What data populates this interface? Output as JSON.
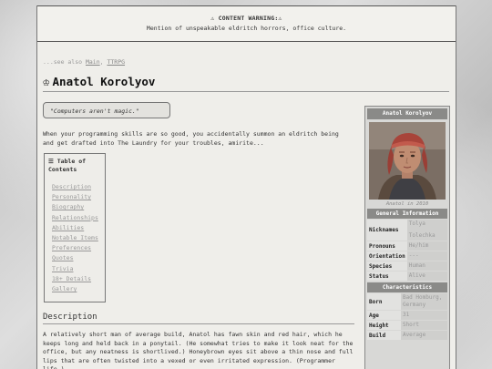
{
  "warning": {
    "title": "⚠ CONTENT WARNING:⚠",
    "text": "Mention of unspeakable eldritch horrors, office culture."
  },
  "see_also": {
    "prefix": "...see also ",
    "links": [
      "Main",
      "TTRPG"
    ],
    "separator": ", "
  },
  "page": {
    "title_icon": "♔",
    "title": "Anatol Korolyov",
    "quote": "\"Computers aren't magic.\"",
    "intro": "When your programming skills are so good, you accidentally summon an eldritch being and get drafted into The Laundry for your troubles, amirite..."
  },
  "toc": {
    "title": "☰ Table of Contents",
    "items": [
      "Description",
      "Personality",
      "Biography",
      "Relationships",
      "Abilities",
      "Notable Items",
      "Preferences",
      "Quotes",
      "Trivia",
      "18+ Details",
      "Gallery"
    ]
  },
  "description": {
    "heading": "Description",
    "text": "A relatively short man of average build, Anatol has fawn skin and red hair, which he keeps long and held back in a ponytail. (He somewhat tries to make it look neat for the office, but any neatness is shortlived.) Honeybrown eyes sit above a thin nose and full lips that are often twisted into a vexed or even irritated expression. (Programmer life.)"
  },
  "infobox": {
    "name": "Anatol Korolyov",
    "caption": "Anatol in 2010",
    "general_heading": "General Information",
    "nicknames_label": "Nicknames",
    "nicknames_1": "Tolya",
    "nicknames_2": "Tolechka",
    "pronouns_label": "Pronouns",
    "pronouns": "He/him",
    "orientation_label": "Orientation",
    "orientation": "---",
    "species_label": "Species",
    "species": "Human",
    "status_label": "Status",
    "status": "Alive",
    "characteristics_heading": "Characteristics",
    "born_label": "Born",
    "born": "Bad Homburg, Germany",
    "age_label": "Age",
    "age": "31",
    "height_label": "Height",
    "height": "Short",
    "build_label": "Build",
    "build": "Average"
  },
  "colors": {
    "page_bg": "#efeeea",
    "infobox_header": "#8a8a88",
    "link": "#888888"
  }
}
